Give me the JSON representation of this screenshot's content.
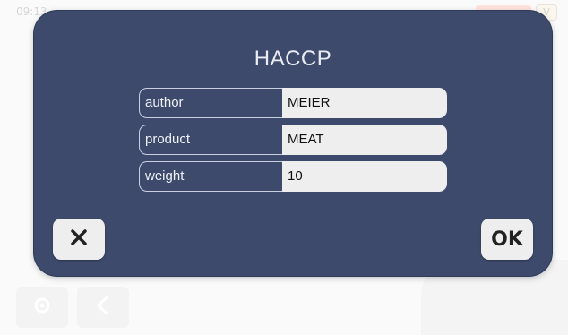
{
  "background": {
    "time_text": "09:13",
    "top_pill_text": "V"
  },
  "dialog": {
    "title": "HACCP",
    "fields": [
      {
        "label": "author",
        "value": "MEIER"
      },
      {
        "label": "product",
        "value": "MEAT"
      },
      {
        "label": "weight",
        "value": "10"
      }
    ],
    "ok_label": "OK",
    "cancel_icon": "close-icon"
  },
  "colors": {
    "dialog_bg": "#3d4a6b",
    "field_bg": "#eeeeee",
    "button_bg": "#eeeeee",
    "title_color": "#e9ecf3"
  }
}
